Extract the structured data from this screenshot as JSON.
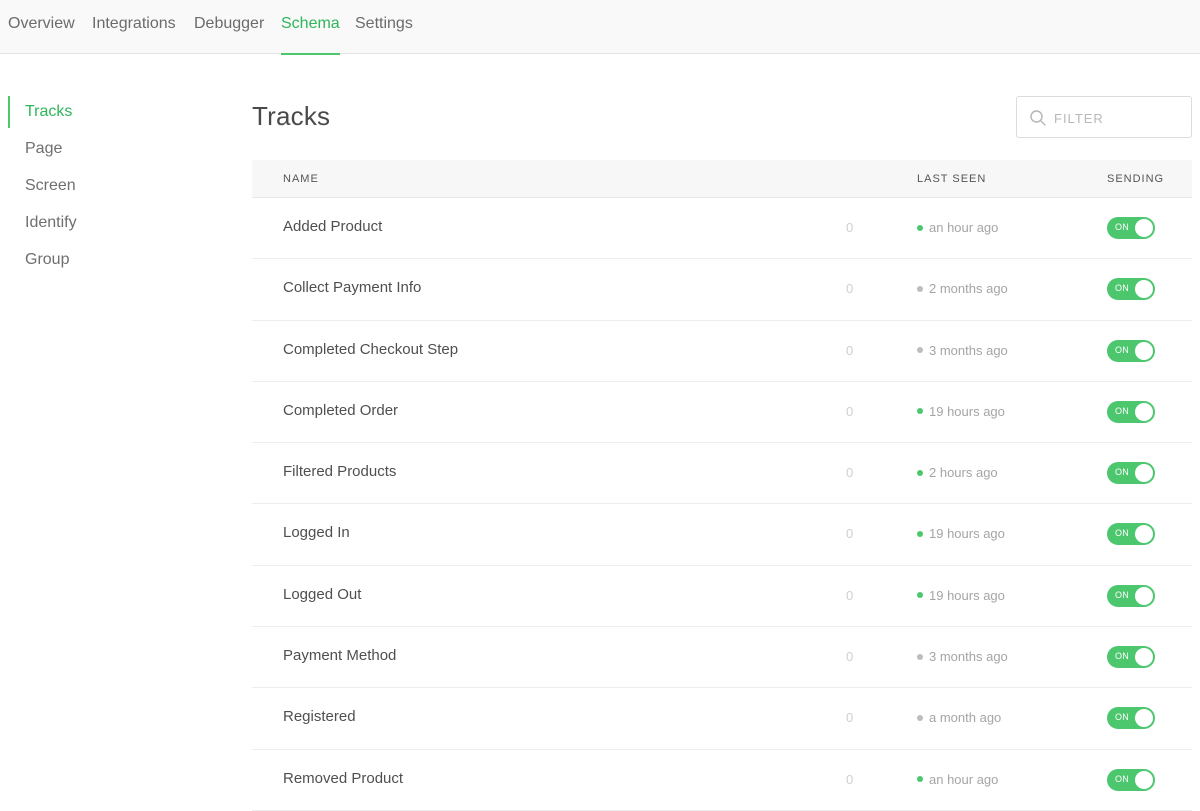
{
  "nav": {
    "tabs": [
      {
        "label": "Overview"
      },
      {
        "label": "Integrations"
      },
      {
        "label": "Debugger"
      },
      {
        "label": "Schema"
      },
      {
        "label": "Settings"
      }
    ],
    "active": "Schema"
  },
  "sidebar": {
    "items": [
      {
        "label": "Tracks"
      },
      {
        "label": "Page"
      },
      {
        "label": "Screen"
      },
      {
        "label": "Identify"
      },
      {
        "label": "Group"
      }
    ],
    "active": "Tracks"
  },
  "main": {
    "title": "Tracks",
    "filter": {
      "placeholder": "FILTER",
      "value": ""
    },
    "columns": {
      "name": "NAME",
      "last_seen": "LAST SEEN",
      "sending": "SENDING"
    },
    "rows": [
      {
        "name": "Added Product",
        "count": "0",
        "last_seen": "an hour ago",
        "status": "green",
        "sending": "ON"
      },
      {
        "name": "Collect Payment Info",
        "count": "0",
        "last_seen": "2 months ago",
        "status": "gray",
        "sending": "ON"
      },
      {
        "name": "Completed Checkout Step",
        "count": "0",
        "last_seen": "3 months ago",
        "status": "gray",
        "sending": "ON"
      },
      {
        "name": "Completed Order",
        "count": "0",
        "last_seen": "19 hours ago",
        "status": "green",
        "sending": "ON"
      },
      {
        "name": "Filtered Products",
        "count": "0",
        "last_seen": "2 hours ago",
        "status": "green",
        "sending": "ON"
      },
      {
        "name": "Logged In",
        "count": "0",
        "last_seen": "19 hours ago",
        "status": "green",
        "sending": "ON"
      },
      {
        "name": "Logged Out",
        "count": "0",
        "last_seen": "19 hours ago",
        "status": "green",
        "sending": "ON"
      },
      {
        "name": "Payment Method",
        "count": "0",
        "last_seen": "3 months ago",
        "status": "gray",
        "sending": "ON"
      },
      {
        "name": "Registered",
        "count": "0",
        "last_seen": "a month ago",
        "status": "gray",
        "sending": "ON"
      },
      {
        "name": "Removed Product",
        "count": "0",
        "last_seen": "an hour ago",
        "status": "green",
        "sending": "ON"
      }
    ]
  },
  "colors": {
    "accent": "#4cc76e",
    "accent_text": "#2fb55a",
    "status_recent": "#4cc76e",
    "status_stale": "#bdbdbd"
  },
  "icons": {
    "filter": "search-icon"
  }
}
